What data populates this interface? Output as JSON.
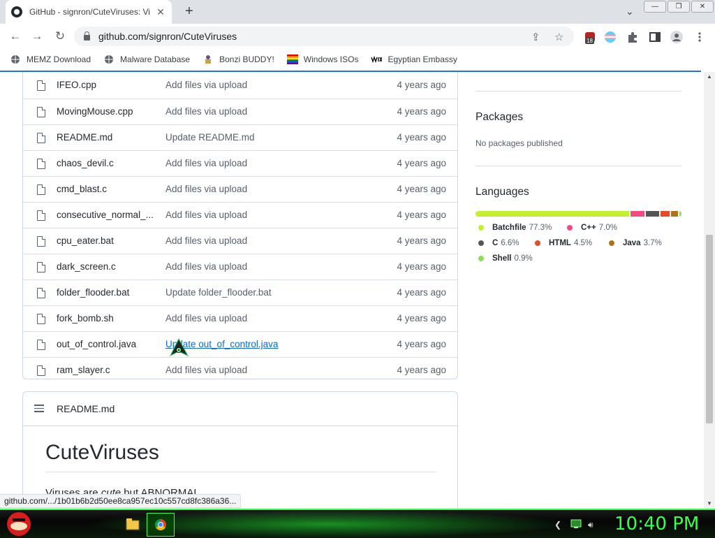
{
  "browser": {
    "tab_title": "GitHub - signron/CuteViruses: Vi",
    "tab_close": "✕",
    "new_tab": "+",
    "tab_search": "⌄",
    "window_buttons": [
      "—",
      "❐",
      "✕"
    ],
    "url": "github.com/signron/CuteViruses",
    "extension_badge": "18",
    "status_url": "github.com/.../1b01b6b2d50ee8ca957ec10c557cd8fc386a36..."
  },
  "bookmarks": [
    {
      "label": "MEMZ Download",
      "icon": "globe-icon"
    },
    {
      "label": "Malware Database",
      "icon": "globe-icon"
    },
    {
      "label": "Bonzi BUDDY!",
      "icon": "bonzi-icon"
    },
    {
      "label": "Windows ISOs",
      "icon": "rainbow-flag-icon"
    },
    {
      "label": "Egyptian Embassy",
      "icon": "wix-icon"
    }
  ],
  "files": [
    {
      "name": "IFEO.cpp",
      "message": "Add files via upload",
      "date": "4 years ago"
    },
    {
      "name": "MovingMouse.cpp",
      "message": "Add files via upload",
      "date": "4 years ago"
    },
    {
      "name": "README.md",
      "message": "Update README.md",
      "date": "4 years ago"
    },
    {
      "name": "chaos_devil.c",
      "message": "Add files via upload",
      "date": "4 years ago"
    },
    {
      "name": "cmd_blast.c",
      "message": "Add files via upload",
      "date": "4 years ago"
    },
    {
      "name": "consecutive_normal_...",
      "message": "Add files via upload",
      "date": "4 years ago"
    },
    {
      "name": "cpu_eater.bat",
      "message": "Add files via upload",
      "date": "4 years ago"
    },
    {
      "name": "dark_screen.c",
      "message": "Add files via upload",
      "date": "4 years ago"
    },
    {
      "name": "folder_flooder.bat",
      "message": "Update folder_flooder.bat",
      "date": "4 years ago"
    },
    {
      "name": "fork_bomb.sh",
      "message": "Add files via upload",
      "date": "4 years ago"
    },
    {
      "name": "out_of_control.java",
      "message": "Update out_of_control.java",
      "date": "4 years ago"
    },
    {
      "name": "ram_slayer.c",
      "message": "Add files via upload",
      "date": "4 years ago"
    }
  ],
  "readme": {
    "file_label": "README.md",
    "heading": "CuteViruses",
    "intro": "Viruses are cute but ABNORMAL"
  },
  "sidebar": {
    "packages_title": "Packages",
    "packages_note": "No packages published",
    "languages_title": "Languages",
    "languages": [
      {
        "name": "Batchfile",
        "percent": "77.3%",
        "value": 77.3,
        "color": "#c1f12e"
      },
      {
        "name": "C++",
        "percent": "7.0%",
        "value": 7.0,
        "color": "#f34b7d"
      },
      {
        "name": "C",
        "percent": "6.6%",
        "value": 6.6,
        "color": "#555555"
      },
      {
        "name": "HTML",
        "percent": "4.5%",
        "value": 4.5,
        "color": "#e34c26"
      },
      {
        "name": "Java",
        "percent": "3.7%",
        "value": 3.7,
        "color": "#b07219"
      },
      {
        "name": "Shell",
        "percent": "0.9%",
        "value": 0.9,
        "color": "#89e051"
      }
    ]
  },
  "taskbar": {
    "clock": "10:40 PM",
    "accent": "#3aff4a"
  }
}
